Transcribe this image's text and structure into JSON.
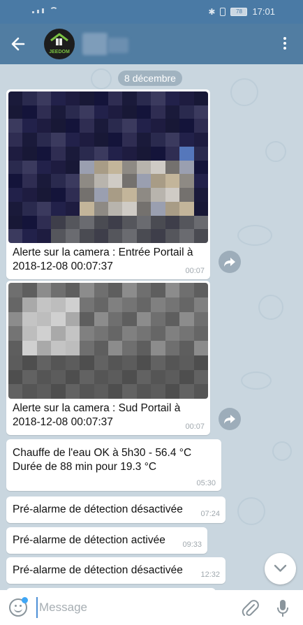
{
  "status_bar": {
    "time": "17:01",
    "battery": "78",
    "icons": [
      "signal-icon",
      "wifi-icon",
      "bluetooth-icon",
      "vibrate-icon",
      "battery-icon"
    ]
  },
  "app_bar": {
    "back_icon": "arrow-left-icon",
    "avatar_text": "JEEDOM",
    "menu_icon": "more-vertical-icon",
    "accent": "#517da2"
  },
  "chat": {
    "date_pill": "8 décembre",
    "messages": [
      {
        "type": "photo",
        "text": "Alerte sur la camera : Entrée Portail à 2018-12-08 00:07:37",
        "time": "00:07"
      },
      {
        "type": "photo",
        "text": "Alerte sur la camera : Sud Portail à 2018-12-08 00:07:37",
        "time": "00:07"
      },
      {
        "type": "text",
        "line1": "Chauffe de l'eau OK à 5h30 - 56.4 °C",
        "line2": "Durée de 88 min pour 19.3 °C",
        "time": "05:30"
      },
      {
        "type": "text",
        "text": "Pré-alarme de détection désactivée",
        "time": "07:24"
      },
      {
        "type": "text",
        "text": "Pré-alarme de détection activée",
        "time": "09:33"
      },
      {
        "type": "text",
        "text": "Pré-alarme de détection désactivée",
        "time": "12:32"
      }
    ]
  },
  "input_bar": {
    "placeholder": "Message",
    "value": "",
    "icons": [
      "emoji-icon",
      "attach-icon",
      "microphone-icon"
    ]
  }
}
